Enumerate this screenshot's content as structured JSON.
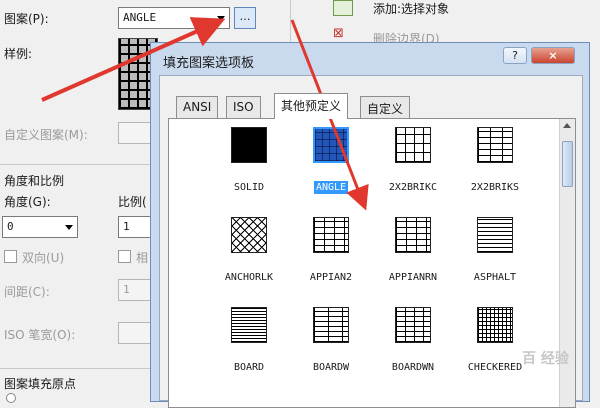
{
  "left_panel": {
    "pattern_label": "图案(P):",
    "pattern_value": "ANGLE",
    "sample_label": "样例:",
    "custom_pattern_label": "自定义图案(M):",
    "angle_scale_section": "角度和比例",
    "angle_label": "角度(G):",
    "angle_value": "0",
    "scale_label": "比例(",
    "scale_value": "1",
    "double_label": "双向(U)",
    "relative_label": "相",
    "spacing_label": "间距(C):",
    "spacing_value": "1",
    "iso_pen_label": "ISO 笔宽(O):",
    "origin_section": "图案填充原点"
  },
  "right_panel": {
    "add_label": "添加:选择对象",
    "remove_label": "删除边界(D)"
  },
  "dialog": {
    "title": "填充图案选项板",
    "help_button": "?",
    "close_button": "×",
    "tabs": [
      "ANSI",
      "ISO",
      "其他预定义",
      "自定义"
    ],
    "active_tab": "其他预定义",
    "patterns": [
      {
        "name": "SOLID",
        "icon": "solid-fill",
        "selected": false
      },
      {
        "name": "ANGLE",
        "icon": "angle-tile",
        "selected": true
      },
      {
        "name": "2X2BRIKC",
        "icon": "brick-basket",
        "selected": false
      },
      {
        "name": "2X2BRIKS",
        "icon": "brick-stack",
        "selected": false
      },
      {
        "name": "ANCHORLK",
        "icon": "anchor-lock",
        "selected": false
      },
      {
        "name": "APPIAN2",
        "icon": "brick-running",
        "selected": false
      },
      {
        "name": "APPIANRN",
        "icon": "brick-running",
        "selected": false
      },
      {
        "name": "ASPHALT",
        "icon": "horizontal-lines",
        "selected": false
      },
      {
        "name": "BOARD",
        "icon": "board-lines",
        "selected": false
      },
      {
        "name": "BOARDW",
        "icon": "board-wide",
        "selected": false
      },
      {
        "name": "BOARDWN",
        "icon": "board-narrow",
        "selected": false
      },
      {
        "name": "CHECKERED",
        "icon": "checker-grid",
        "selected": false
      }
    ]
  },
  "colors": {
    "arrow": "#e0382e",
    "selection": "#3399ff",
    "dialog_frame": "#c9daee"
  },
  "watermark": "百 经验"
}
